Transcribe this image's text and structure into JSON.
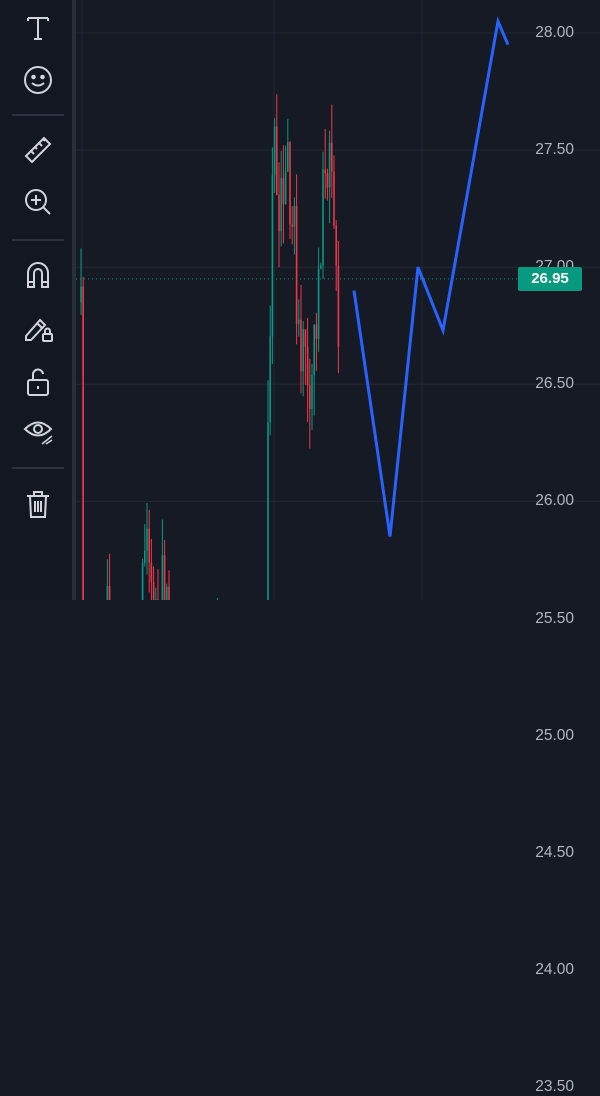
{
  "toolbar": {
    "tools": [
      {
        "icon": "text-icon",
        "label": "T"
      },
      {
        "icon": "emoji-icon"
      },
      {
        "icon": "ruler-icon"
      },
      {
        "icon": "zoom-in-icon"
      },
      {
        "icon": "magnet-icon"
      },
      {
        "icon": "pencil-lock-icon"
      },
      {
        "icon": "unlock-icon"
      },
      {
        "icon": "eye-icon"
      },
      {
        "icon": "trash-icon"
      }
    ]
  },
  "price_axis": {
    "labels": [
      "28.00",
      "27.50",
      "27.00",
      "26.50",
      "26.00",
      "25.50",
      "25.00",
      "24.50",
      "24.00",
      "23.50"
    ],
    "current_price": "26.95"
  },
  "colors": {
    "background": "#161a25",
    "up": "#089981",
    "down": "#f23645",
    "drawing": "#2962ff",
    "badge": "#089981"
  },
  "chart_data": {
    "type": "candlestick",
    "ylim": [
      23.3,
      28.25
    ],
    "current_price": 26.95,
    "drawing_line": {
      "type": "polyline",
      "price_points": [
        26.9,
        25.85,
        27.0,
        26.73,
        28.05,
        27.95
      ]
    }
  }
}
